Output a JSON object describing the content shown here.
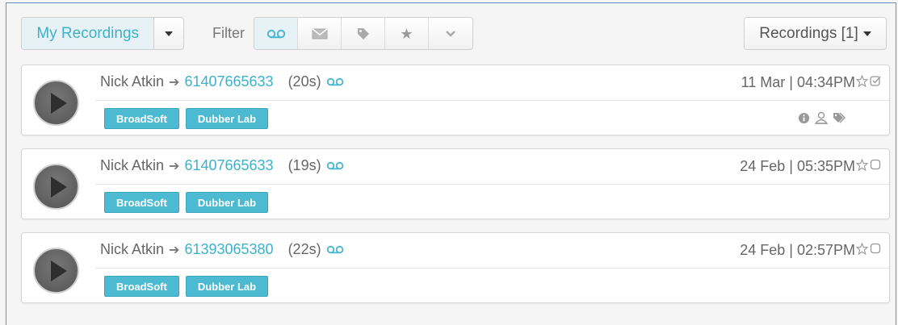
{
  "toolbar": {
    "mine_label": "My Recordings",
    "filter_label": "Filter",
    "filters": [
      {
        "icon": "voicemail-icon"
      },
      {
        "icon": "mail-icon"
      },
      {
        "icon": "tag-icon"
      },
      {
        "icon": "star-icon"
      },
      {
        "icon": "chevron-down-icon"
      }
    ],
    "recordings_label": "Recordings [1]"
  },
  "recordings": [
    {
      "caller": "Nick Atkin",
      "number": "61407665633",
      "duration": "(20s)",
      "date": "11 Mar | 04:34PM",
      "tags": [
        "BroadSoft",
        "Dubber Lab"
      ],
      "checked": true
    },
    {
      "caller": "Nick Atkin",
      "number": "61407665633",
      "duration": "(19s)",
      "date": "24 Feb | 05:35PM",
      "tags": [
        "BroadSoft",
        "Dubber Lab"
      ],
      "checked": false
    },
    {
      "caller": "Nick Atkin",
      "number": "61393065380",
      "duration": "(22s)",
      "date": "24 Feb | 02:57PM",
      "tags": [
        "BroadSoft",
        "Dubber Lab"
      ],
      "checked": false
    }
  ],
  "colors": {
    "accent": "#3fb0c9",
    "tag_bg": "#4cbad1",
    "frame_border": "#6d8fbf"
  }
}
